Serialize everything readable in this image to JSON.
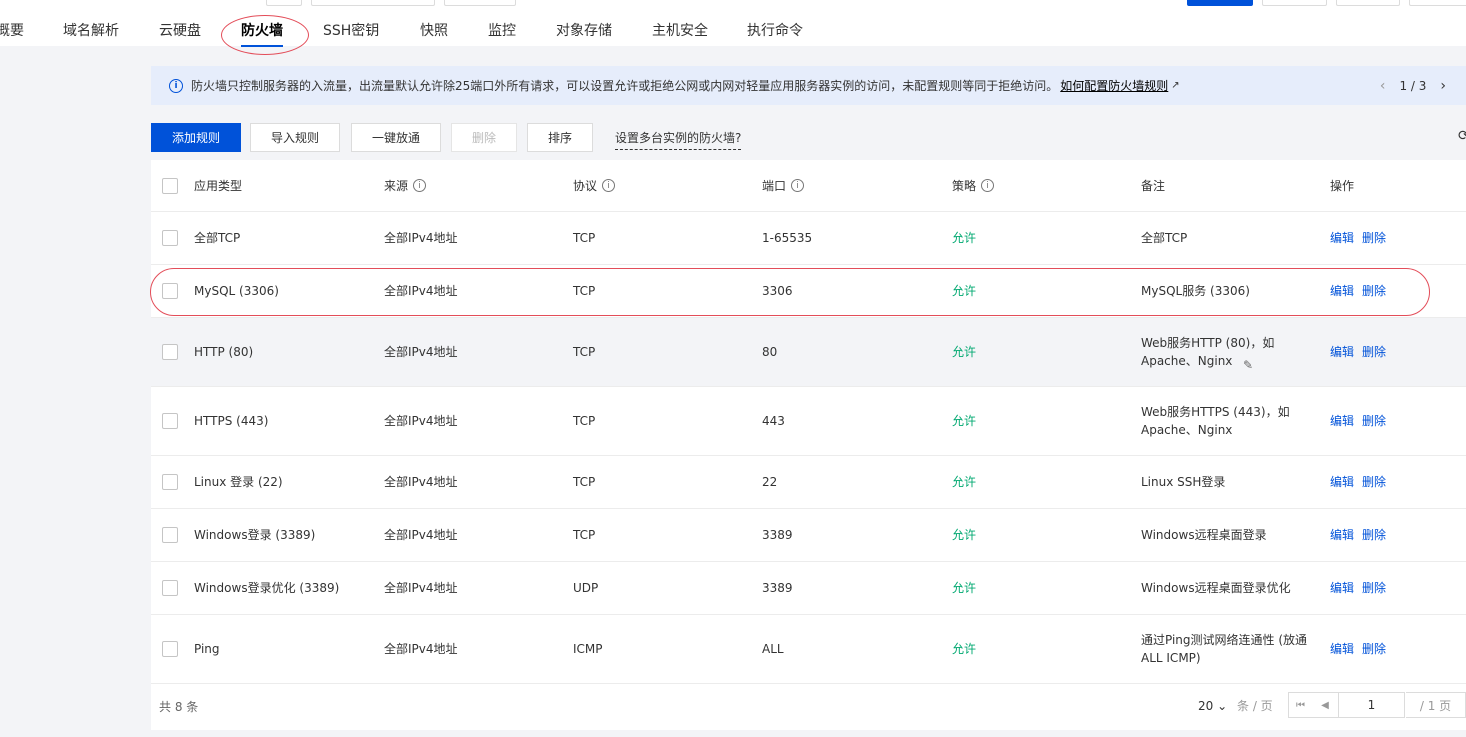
{
  "tabs": [
    {
      "label": "概要"
    },
    {
      "label": "域名解析"
    },
    {
      "label": "云硬盘"
    },
    {
      "label": "防火墙",
      "active": true
    },
    {
      "label": "SSH密钥"
    },
    {
      "label": "快照"
    },
    {
      "label": "监控"
    },
    {
      "label": "对象存储"
    },
    {
      "label": "主机安全"
    },
    {
      "label": "执行命令"
    }
  ],
  "notice": {
    "text": "防火墙只控制服务器的入流量，出流量默认允许除25端口外所有请求，可以设置允许或拒绝公网或内网对轻量应用服务器实例的访问，未配置规则等同于拒绝访问。",
    "link": "如何配置防火墙规则",
    "page": "1 / 3",
    "icon": "info-icon"
  },
  "toolbar": {
    "add": "添加规则",
    "import": "导入规则",
    "one_click": "一键放通",
    "delete": "删除",
    "sort": "排序",
    "multi": "设置多台实例的防火墙?"
  },
  "table": {
    "headers": [
      "应用类型",
      "来源",
      "协议",
      "端口",
      "策略",
      "备注",
      "操作"
    ],
    "rows": [
      {
        "type": "全部TCP",
        "source": "全部IPv4地址",
        "protocol": "TCP",
        "port": "1-65535",
        "policy": "允许",
        "note": "全部TCP"
      },
      {
        "type": "MySQL (3306)",
        "source": "全部IPv4地址",
        "protocol": "TCP",
        "port": "3306",
        "policy": "允许",
        "note": "MySQL服务 (3306)"
      },
      {
        "type": "HTTP (80)",
        "source": "全部IPv4地址",
        "protocol": "TCP",
        "port": "80",
        "policy": "允许",
        "note": "Web服务HTTP (80)，如Apache、Nginx"
      },
      {
        "type": "HTTPS (443)",
        "source": "全部IPv4地址",
        "protocol": "TCP",
        "port": "443",
        "policy": "允许",
        "note": "Web服务HTTPS (443)，如Apache、Nginx"
      },
      {
        "type": "Linux 登录 (22)",
        "source": "全部IPv4地址",
        "protocol": "TCP",
        "port": "22",
        "policy": "允许",
        "note": "Linux SSH登录"
      },
      {
        "type": "Windows登录 (3389)",
        "source": "全部IPv4地址",
        "protocol": "TCP",
        "port": "3389",
        "policy": "允许",
        "note": "Windows远程桌面登录"
      },
      {
        "type": "Windows登录优化 (3389)",
        "source": "全部IPv4地址",
        "protocol": "UDP",
        "port": "3389",
        "policy": "允许",
        "note": "Windows远程桌面登录优化"
      },
      {
        "type": "Ping",
        "source": "全部IPv4地址",
        "protocol": "ICMP",
        "port": "ALL",
        "policy": "允许",
        "note": "通过Ping测试网络连通性 (放通ALL ICMP)"
      }
    ],
    "edit_label": "编辑",
    "delete_label": "删除"
  },
  "footer": {
    "total": "共 8 条",
    "page_size": "20",
    "page_size_unit": "条 / 页",
    "current_page": "1",
    "total_pages": "/ 1 页"
  },
  "colors": {
    "primary": "#0052d9",
    "allow": "#00a870",
    "annotation": "#e34d59"
  }
}
